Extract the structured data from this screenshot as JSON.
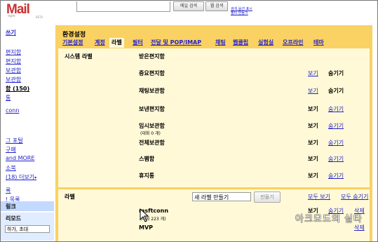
{
  "header": {
    "logo_text": "Mail",
    "logo_sub": "ogle",
    "logo_beta": "BETA",
    "search_mail_btn": "메일 검색",
    "search_web_btn": "웹 검색",
    "search_options_link": "검색 옵션 표시",
    "filter_link": "필터 만들기"
  },
  "sidebar": {
    "compose": "쓰기",
    "items": [
      "편지함",
      "편지함",
      "보관함",
      "보관함",
      "함 (150)",
      "통"
    ],
    "contact": "conn",
    "links": [
      "그 포털",
      "구매",
      "and MORE",
      "소북",
      "(18) 더보기"
    ],
    "more_caret": "▾",
    "lower_links": [
      "록",
      "! 목록"
    ],
    "box1_label": "링크",
    "box2_label": "리모드",
    "box2_input": "하가, 초대"
  },
  "settings": {
    "title": "환경설정",
    "tabs": [
      "기본설정",
      "계정",
      "라벨",
      "필터",
      "전달 및 POP/IMAP",
      "채팅",
      "웹클립",
      "실험실",
      "오프라인",
      "테마"
    ],
    "active_tab": 2,
    "system_labels_title": "시스템 라벨",
    "system_labels": [
      {
        "name": "받은편지함",
        "sub": "",
        "show": "",
        "hide": ""
      },
      {
        "name": "중요편지함",
        "sub": "",
        "show": "보기",
        "hide": "숨기기"
      },
      {
        "name": "채팅보관함",
        "sub": "",
        "show": "보기",
        "hide": "숨기기"
      },
      {
        "name": "보낸편지함",
        "sub": "",
        "show": "보기",
        "hide": "숨기기"
      },
      {
        "name": "임시보관함",
        "sub": "(대화 0 개)",
        "show": "보기",
        "hide": "숨기기"
      },
      {
        "name": "전체보관함",
        "sub": "",
        "show": "보기",
        "hide": "숨기기"
      },
      {
        "name": "스팸함",
        "sub": "",
        "show": "보기",
        "hide": "숨기기"
      },
      {
        "name": "휴지통",
        "sub": "",
        "show": "보기",
        "hide": "숨기기"
      }
    ],
    "labels_title": "라벨",
    "new_label_placeholder": "새 라벨 만들기",
    "make_button": "만들기",
    "show_all": "모두 보기",
    "hide_all": "모두 숨기기",
    "user_labels": [
      {
        "name": "msftconn",
        "sub": "(대화 223 개)",
        "show": "보기",
        "hide": "숨기기",
        "delete": "삭제"
      },
      {
        "name": "MVP",
        "sub": "",
        "show": "",
        "hide": "",
        "delete": "삭제"
      }
    ],
    "watermark": "아크모드의 실타"
  },
  "colors": {
    "panel": "#fad163",
    "panel_inner": "#fff9d7",
    "link": "#2222cc",
    "logo_red": "#cc3333"
  }
}
